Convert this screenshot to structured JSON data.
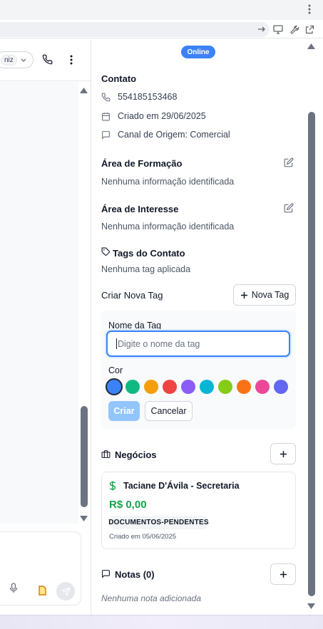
{
  "browser": {
    "menu_icon": "kebab-vertical-icon",
    "toolbar_icons": [
      "arrow-right-icon",
      "monitor-icon",
      "wrench-icon",
      "external-link-icon"
    ]
  },
  "left_panel": {
    "select_value": "niz",
    "icons": [
      "chevron-down-icon",
      "phone-icon",
      "more-vertical-icon",
      "mic-icon",
      "file-icon",
      "send-icon"
    ]
  },
  "status": {
    "label": "Online",
    "color": "#3b82f6"
  },
  "contact": {
    "title": "Contato",
    "phone": "554185153468",
    "created": "Criado em 29/06/2025",
    "origin": "Canal de Origem: Comercial"
  },
  "formacao": {
    "title": "Área de Formação",
    "value": "Nenhuma informação identificada"
  },
  "interesse": {
    "title": "Área de Interesse",
    "value": "Nenhuma informação identificada"
  },
  "tags": {
    "title": "Tags do Contato",
    "empty": "Nenhuma tag aplicada"
  },
  "new_tag": {
    "title": "Criar Nova Tag",
    "button_label": "Nova Tag",
    "name_label": "Nome da Tag",
    "name_placeholder": "Digite o nome da tag",
    "color_label": "Cor",
    "colors": [
      "#3b82f6",
      "#10b981",
      "#f59e0b",
      "#ef4444",
      "#8b5cf6",
      "#06b6d4",
      "#84cc16",
      "#f97316",
      "#ec4899",
      "#6366f1"
    ],
    "selected_color": "#3b82f6",
    "create_label": "Criar",
    "cancel_label": "Cancelar"
  },
  "deals": {
    "title": "Negócios",
    "items": [
      {
        "name": "Taciane D'Ávila - Secretaria",
        "value": "R$ 0,00",
        "stage": "DOCUMENTOS-PENDENTES",
        "created": "Criado em 05/06/2025"
      }
    ]
  },
  "notes": {
    "title": "Notas (0)",
    "empty": "Nenhuma nota adicionada"
  }
}
